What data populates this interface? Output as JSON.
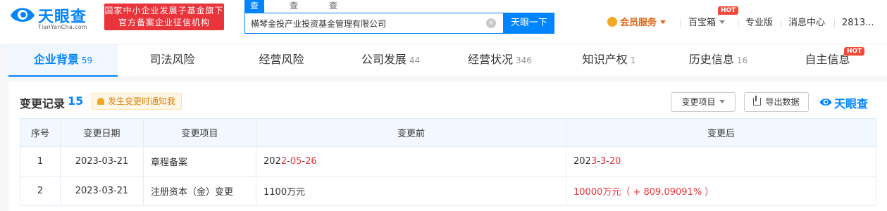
{
  "header": {
    "logo_text": "天眼查",
    "logo_sub": "TianYanCha.com",
    "red_banner_line1": "国家中小企业发展子基金旗下",
    "red_banner_line2": "官方备案企业征信机构",
    "search_tabs": [
      "查公司",
      "查老板",
      "查关系"
    ],
    "search_value": "横琴金投产业投资基金管理有限公司",
    "search_button": "天眼一下",
    "clear_symbol": "×",
    "nav": {
      "vip": "会员服务",
      "treasure": "百宝箱",
      "pro": "专业版",
      "messages": "消息中心",
      "user": "2813..."
    },
    "hot_badge": "HOT"
  },
  "tabs": [
    {
      "label": "企业背景",
      "count": "59"
    },
    {
      "label": "司法风险",
      "count": ""
    },
    {
      "label": "经营风险",
      "count": ""
    },
    {
      "label": "公司发展",
      "count": "44"
    },
    {
      "label": "经营状况",
      "count": "346"
    },
    {
      "label": "知识产权",
      "count": "1"
    },
    {
      "label": "历史信息",
      "count": "16"
    },
    {
      "label": "自主信息",
      "count": ""
    }
  ],
  "section": {
    "title": "变更记录",
    "count": "15",
    "notify": "发生变更时通知我",
    "filter_button": "变更项目",
    "export_button": "导出数据",
    "mini_logo": "天眼查"
  },
  "table": {
    "headers": [
      "序号",
      "变更日期",
      "变更项目",
      "变更前",
      "变更后"
    ],
    "rows": [
      {
        "index": "1",
        "date": "2023-03-21",
        "item": "章程备案",
        "before": [
          {
            "t": "202",
            "h": false
          },
          {
            "t": "2",
            "h": true
          },
          {
            "t": "-",
            "h": false
          },
          {
            "t": "05",
            "h": true
          },
          {
            "t": "-",
            "h": false
          },
          {
            "t": "26",
            "h": true
          }
        ],
        "after": [
          {
            "t": "202",
            "h": false
          },
          {
            "t": "3",
            "h": true
          },
          {
            "t": "-",
            "h": false
          },
          {
            "t": "3",
            "h": true
          },
          {
            "t": "-",
            "h": false
          },
          {
            "t": "20",
            "h": true
          }
        ]
      },
      {
        "index": "2",
        "date": "2023-03-21",
        "item": "注册资本（金）变更",
        "before": [
          {
            "t": "1100万元",
            "h": false
          }
        ],
        "after": [
          {
            "t": "10000万元（ + 809.09091% ）",
            "h": true
          }
        ]
      }
    ]
  },
  "colors": {
    "brand_blue": "#0084ff",
    "banner_red": "#e9343b",
    "vip_orange": "#e0620f"
  }
}
